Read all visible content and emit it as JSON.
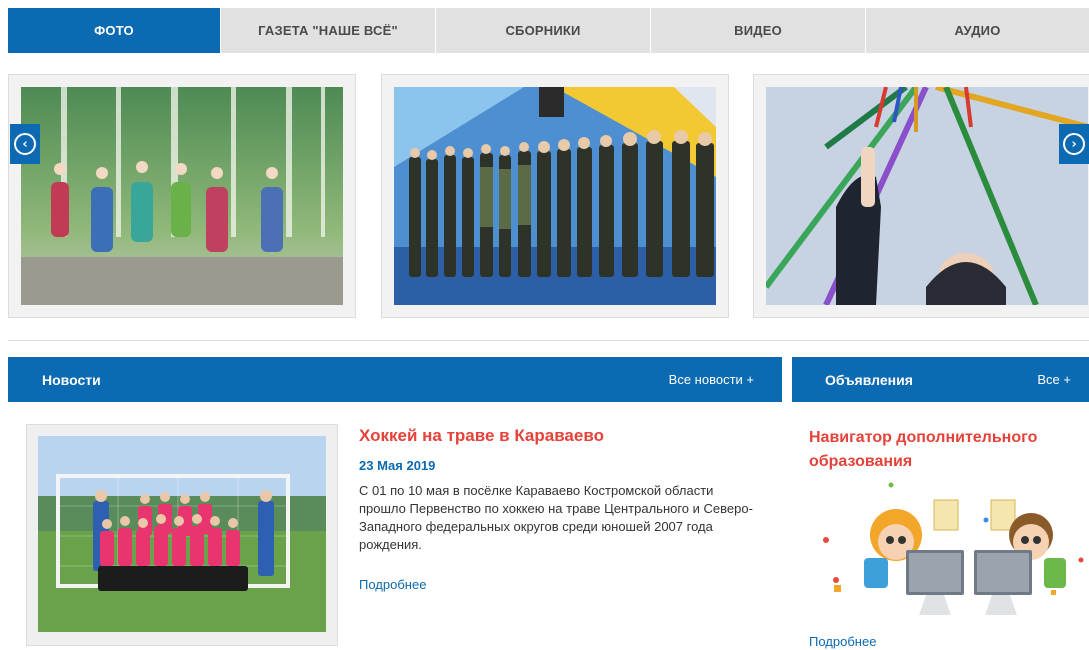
{
  "tabs": [
    {
      "label": "ФОТО",
      "active": true
    },
    {
      "label": "ГАЗЕТА \"НАШЕ ВСЁ\"",
      "active": false
    },
    {
      "label": "СБОРНИКИ",
      "active": false
    },
    {
      "label": "ВИДЕО",
      "active": false
    },
    {
      "label": "АУДИО",
      "active": false
    }
  ],
  "carousel": {
    "prev_icon": "chevron-left-circle-icon",
    "next_icon": "chevron-right-circle-icon",
    "slides": [
      {
        "subject": "folk-dancers-photo"
      },
      {
        "subject": "cadets-in-gym-photo"
      },
      {
        "subject": "maypole-ribbons-photo"
      }
    ]
  },
  "news": {
    "header_title": "Новости",
    "header_more": "Все новости +",
    "item": {
      "title": "Хоккей на траве в Караваево",
      "date": "23 Мая 2019",
      "text": "С 01 по 10 мая в посёлке Караваево Костромской области прошло Первенство по хоккею на траве Центрального и Северо-Западного федеральных округов среди юношей 2007 года рождения.",
      "more": "Подробнее"
    }
  },
  "announcements": {
    "header_title": "Объявления",
    "header_more": "Все +",
    "item": {
      "title": "Навигатор дополнительного образования",
      "more": "Подробнее"
    }
  },
  "colors": {
    "accent": "#0b6ab2",
    "headline": "#e5433a",
    "tab_bg": "#e1e1e1"
  }
}
